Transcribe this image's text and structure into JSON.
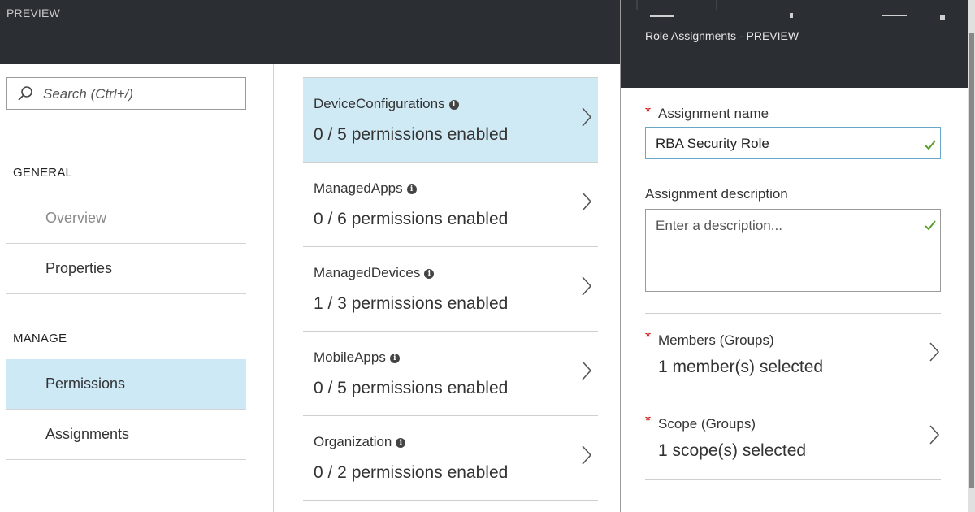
{
  "header": {
    "preview_label": "PREVIEW"
  },
  "nav": {
    "search_placeholder": "Search (Ctrl+/)",
    "general_heading": "GENERAL",
    "manage_heading": "MANAGE",
    "items": [
      {
        "label": "Overview"
      },
      {
        "label": "Properties"
      },
      {
        "label": "Permissions"
      },
      {
        "label": "Assignments"
      }
    ]
  },
  "permissions": [
    {
      "name": "DeviceConfigurations",
      "count": "0 / 5 permissions enabled"
    },
    {
      "name": "ManagedApps",
      "count": "0 / 6 permissions enabled"
    },
    {
      "name": "ManagedDevices",
      "count": "1 / 3 permissions enabled"
    },
    {
      "name": "MobileApps",
      "count": "0 / 5 permissions enabled"
    },
    {
      "name": "Organization",
      "count": "0 / 2 permissions enabled"
    }
  ],
  "blade": {
    "title": "Role Assignments - PREVIEW",
    "assignment_name_label": "Assignment name",
    "assignment_name_value": "RBA Security Role",
    "assignment_description_label": "Assignment description",
    "assignment_description_placeholder": "Enter a description...",
    "members_label": "Members (Groups)",
    "members_value": "1 member(s) selected",
    "scope_label": "Scope (Groups)",
    "scope_value": "1 scope(s) selected",
    "required_mark": "*"
  },
  "colors": {
    "header_bg": "#2b2e33",
    "selected_bg": "#cde9f6",
    "required": "#cc0000",
    "valid_check": "#5aa02c"
  },
  "icons": {
    "search": "search-icon",
    "info": "info-icon",
    "chevron": "chevron-right-icon",
    "check": "checkmark-icon"
  }
}
